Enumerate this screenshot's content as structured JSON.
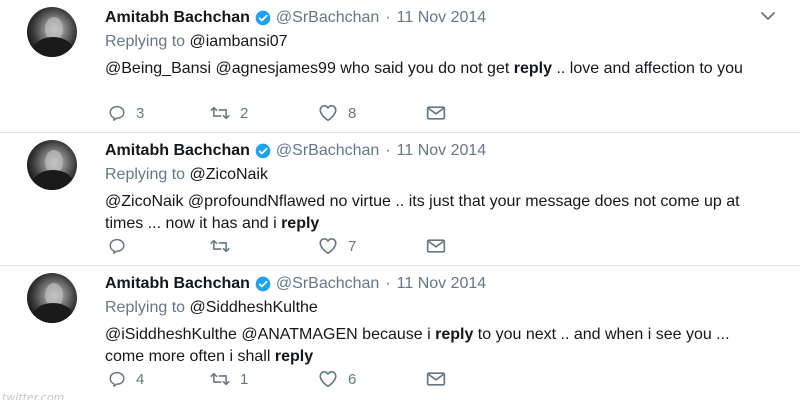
{
  "colors": {
    "verified_blue": "#1da1f2",
    "secondary_text": "#657786",
    "primary_text": "#14171a",
    "divider": "#e1e8ed"
  },
  "tweets": [
    {
      "name": "Amitabh Bachchan",
      "handle": "@SrBachchan",
      "separator": "·",
      "date": "11 Nov 2014",
      "replying_prefix": "Replying to",
      "replying_to": "@iambansi07",
      "text_parts": [
        "@Being_Bansi @agnesjames99 who said you do not get ",
        "reply",
        " .. love and affection to you"
      ],
      "replies": "3",
      "retweets": "2",
      "likes": "8"
    },
    {
      "name": "Amitabh Bachchan",
      "handle": "@SrBachchan",
      "separator": "·",
      "date": "11 Nov 2014",
      "replying_prefix": "Replying to",
      "replying_to": "@ZicoNaik",
      "text_parts": [
        "@ZicoNaik @profoundNflawed no virtue .. its just that your message does not come up at times ... now it has and i ",
        "reply",
        ""
      ],
      "replies": "",
      "retweets": "",
      "likes": "7"
    },
    {
      "name": "Amitabh Bachchan",
      "handle": "@SrBachchan",
      "separator": "·",
      "date": "11 Nov 2014",
      "replying_prefix": "Replying to",
      "replying_to": "@SiddheshKulthe",
      "text_parts": [
        "@iSiddheshKulthe @ANATMAGEN because i ",
        "reply",
        " to you next .. and when i see you ... come more often i shall ",
        "reply",
        ""
      ],
      "replies": "4",
      "retweets": "1",
      "likes": "6"
    }
  ],
  "icons": {
    "avatar": "avatar-photo",
    "verified": "verified-badge-icon",
    "more": "chevron-down-icon",
    "reply": "reply-icon",
    "retweet": "retweet-icon",
    "like": "heart-icon",
    "dm": "envelope-icon"
  },
  "watermark": "twitter.com"
}
